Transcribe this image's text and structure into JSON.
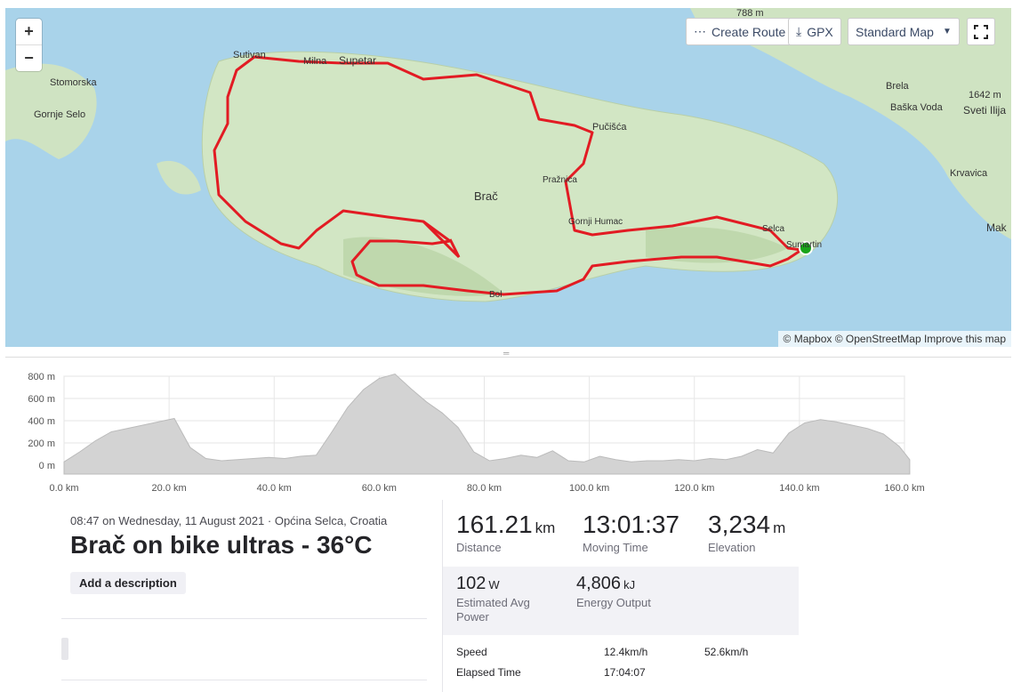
{
  "map": {
    "zoom_in": "+",
    "zoom_out": "−",
    "create_route": "Create Route",
    "gpx": "GPX",
    "map_style": "Standard Map",
    "attribution": "© Mapbox © OpenStreetMap Improve this map",
    "places": [
      "Stomorska",
      "Gornje Selo",
      "Sutivan",
      "Milna",
      "Supetar",
      "Pučišća",
      "Pražnica",
      "Brač",
      "Gornji Humac",
      "Selca",
      "Sumartin",
      "Bol",
      "Brela",
      "Baška Voda",
      "Krvavica",
      "Mak",
      "788 m",
      "1642 m",
      "Sveti Ilija"
    ]
  },
  "elevation": {
    "y_ticks": [
      "800 m",
      "600 m",
      "400 m",
      "200 m",
      "0 m"
    ],
    "x_ticks": [
      "0.0 km",
      "20.0 km",
      "40.0 km",
      "60.0 km",
      "80.0 km",
      "100.0 km",
      "120.0 km",
      "140.0 km",
      "160.0 km"
    ],
    "series_km": [
      0,
      3,
      6,
      9,
      12,
      15,
      18,
      21,
      24,
      27,
      30,
      33,
      36,
      39,
      42,
      45,
      48,
      51,
      54,
      57,
      60,
      63,
      66,
      69,
      72,
      75,
      78,
      81,
      84,
      87,
      90,
      93,
      96,
      99,
      102,
      105,
      108,
      111,
      114,
      117,
      120,
      123,
      126,
      129,
      132,
      135,
      138,
      141,
      144,
      147,
      150,
      153,
      156,
      159,
      161
    ],
    "series_m": [
      30,
      120,
      220,
      300,
      330,
      360,
      390,
      420,
      160,
      60,
      40,
      50,
      60,
      70,
      60,
      80,
      90,
      300,
      520,
      680,
      780,
      820,
      690,
      570,
      470,
      340,
      120,
      40,
      60,
      90,
      70,
      130,
      40,
      30,
      80,
      50,
      30,
      40,
      40,
      50,
      40,
      60,
      50,
      80,
      140,
      110,
      290,
      380,
      410,
      390,
      360,
      330,
      280,
      170,
      50
    ]
  },
  "activity": {
    "datetime": "08:47 on Wednesday, 11 August 2021 · Općina Selca, Croatia",
    "title": "Brač on bike ultras - 36°C",
    "add_description": "Add a description"
  },
  "stats": {
    "distance": {
      "value": "161.21",
      "unit": "km",
      "label": "Distance"
    },
    "moving_time": {
      "value": "13:01:37",
      "label": "Moving Time"
    },
    "elevation": {
      "value": "3,234",
      "unit": "m",
      "label": "Elevation"
    },
    "power": {
      "value": "102",
      "unit": "W",
      "label": "Estimated Avg Power"
    },
    "energy": {
      "value": "4,806",
      "unit": "kJ",
      "label": "Energy Output"
    },
    "speed": {
      "label": "Speed",
      "avg": "12.4km/h",
      "max": "52.6km/h"
    },
    "elapsed": {
      "label": "Elapsed Time",
      "value": "17:04:07"
    }
  }
}
